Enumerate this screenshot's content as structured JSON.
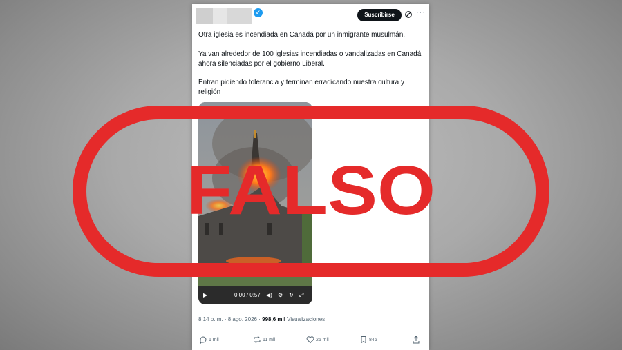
{
  "tweet": {
    "subscribe_label": "Suscribirse",
    "lines": [
      "Otra iglesia es incendiada en Canadá por un inmigrante musulmán.",
      "Ya van alrededor de 100 iglesias incendiadas o vandalizadas en Canadá",
      "ahora silenciadas por el gobierno Liberal.",
      "Entran pidiendo tolerancia y terminan erradicando nuestra cultura y",
      "religión"
    ],
    "video": {
      "time": "0:00 / 0:57",
      "progress": 0
    },
    "meta": {
      "time": "8:14 p. m.",
      "sep": "·",
      "date": "8 ago. 2026",
      "sep2": "·",
      "views": "998,6 mil",
      "views_label": "Visualizaciones"
    },
    "actions": {
      "replies": "1 mil",
      "reposts": "11 mil",
      "likes": "25 mil",
      "bookmarks": "846"
    }
  },
  "overlay": {
    "stamp_text": "FALSO",
    "stamp_color": "#e52a2a"
  },
  "colors": {
    "accent": "#1d9bf0",
    "text": "#0f1419",
    "muted": "#536471"
  }
}
